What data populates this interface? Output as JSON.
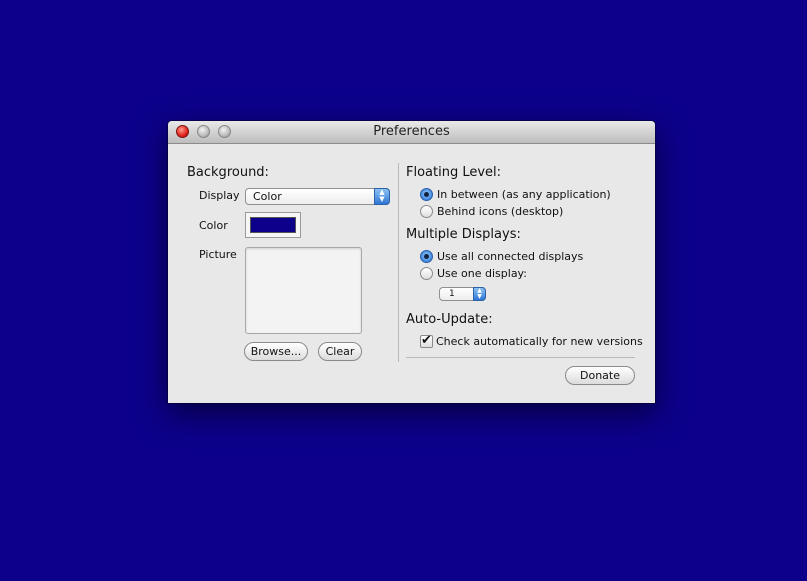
{
  "window": {
    "title": "Preferences"
  },
  "background": {
    "heading": "Background:",
    "display_label": "Display",
    "display_value": "Color",
    "color_label": "Color",
    "color_value": "#0c008a",
    "picture_label": "Picture",
    "browse_label": "Browse...",
    "clear_label": "Clear"
  },
  "floating_level": {
    "heading": "Floating Level:",
    "options": [
      {
        "label": "In between (as any application)",
        "selected": true
      },
      {
        "label": "Behind icons (desktop)",
        "selected": false
      }
    ]
  },
  "multiple_displays": {
    "heading": "Multiple Displays:",
    "options": [
      {
        "label": "Use all connected displays",
        "selected": true
      },
      {
        "label": "Use one display:",
        "selected": false
      }
    ],
    "display_number": "1"
  },
  "auto_update": {
    "heading": "Auto-Update:",
    "check_label": "Check automatically for new versions",
    "checked": true
  },
  "donate_label": "Donate",
  "colors": {
    "desktop": "#0c008a",
    "accent": "#3c86df"
  }
}
